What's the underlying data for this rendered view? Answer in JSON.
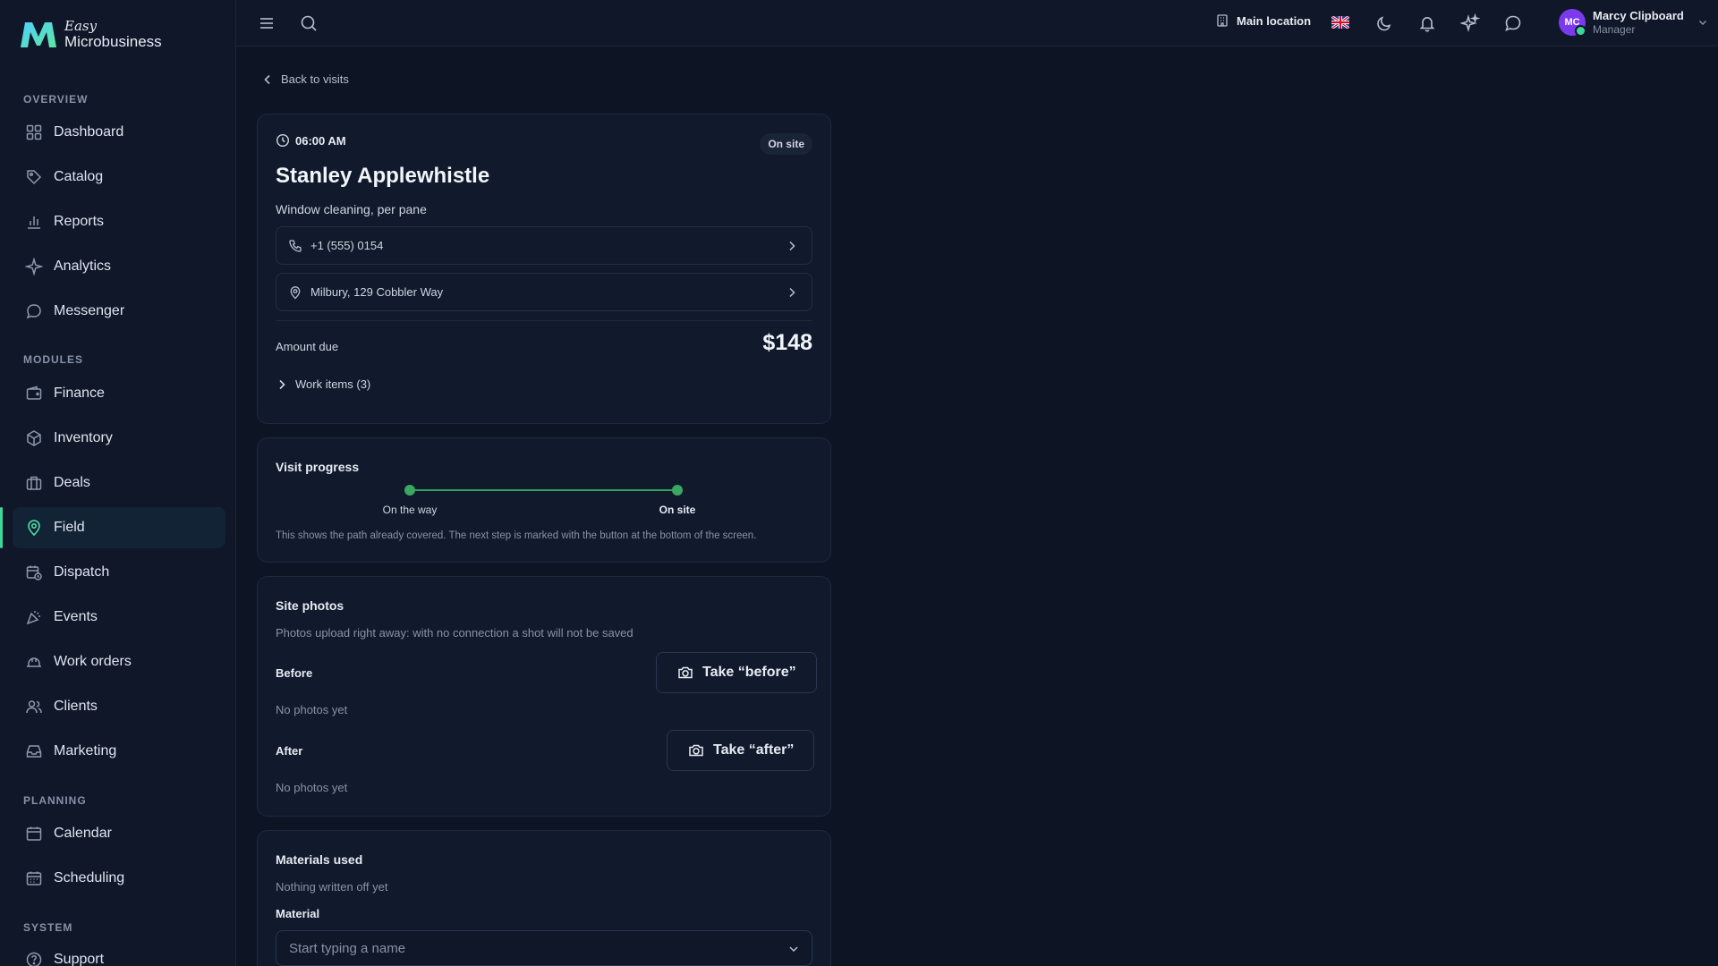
{
  "brand": {
    "top": "Easy",
    "bottom": "Microbusiness"
  },
  "sidebar": {
    "overview_label": "OVERVIEW",
    "overview": [
      {
        "label": "Dashboard",
        "icon": "grid-icon"
      },
      {
        "label": "Catalog",
        "icon": "tag-icon"
      },
      {
        "label": "Reports",
        "icon": "bar-chart-icon"
      },
      {
        "label": "Analytics",
        "icon": "sparkle-icon"
      },
      {
        "label": "Messenger",
        "icon": "chat-icon"
      }
    ],
    "modules_label": "MODULES",
    "modules": [
      {
        "label": "Finance",
        "icon": "wallet-icon"
      },
      {
        "label": "Inventory",
        "icon": "box-icon"
      },
      {
        "label": "Deals",
        "icon": "briefcase-icon"
      },
      {
        "label": "Field",
        "icon": "map-pin-icon",
        "active": true
      },
      {
        "label": "Dispatch",
        "icon": "calendar-clock-icon"
      },
      {
        "label": "Events",
        "icon": "party-icon"
      },
      {
        "label": "Work orders",
        "icon": "hard-hat-icon"
      },
      {
        "label": "Clients",
        "icon": "users-icon"
      },
      {
        "label": "Marketing",
        "icon": "inbox-icon"
      }
    ],
    "planning_label": "PLANNING",
    "planning": [
      {
        "label": "Calendar",
        "icon": "calendar-icon"
      },
      {
        "label": "Scheduling",
        "icon": "calendar-grid-icon"
      }
    ],
    "system_label": "SYSTEM",
    "system": [
      {
        "label": "Support",
        "icon": "help-icon"
      }
    ]
  },
  "topbar": {
    "location": "Main location",
    "user_initials": "MC",
    "user_name": "Marcy Clipboard",
    "user_role": "Manager"
  },
  "back_label": "Back to visits",
  "visit": {
    "time": "06:00 AM",
    "status": "On site",
    "client": "Stanley Applewhistle",
    "service": "Window cleaning, per pane",
    "phone": "+1 (555) 0154",
    "address": "Milbury, 129 Cobbler Way",
    "amount_label": "Amount due",
    "amount": "$148",
    "work_items": "Work items (3)"
  },
  "progress": {
    "title": "Visit progress",
    "steps": [
      "On the way",
      "On site"
    ],
    "note": "This shows the path already covered. The next step is marked with the button at the bottom of the screen."
  },
  "photos": {
    "title": "Site photos",
    "note": "Photos upload right away: with no connection a shot will not be saved",
    "before_label": "Before",
    "before_button": "Take “before”",
    "before_empty": "No photos yet",
    "after_label": "After",
    "after_button": "Take “after”",
    "after_empty": "No photos yet"
  },
  "materials": {
    "title": "Materials used",
    "empty": "Nothing written off yet",
    "field_label": "Material",
    "placeholder": "Start typing a name"
  },
  "colors": {
    "accent": "#3fd69a",
    "progress": "#3aa860",
    "avatar": "#7c3aed"
  }
}
